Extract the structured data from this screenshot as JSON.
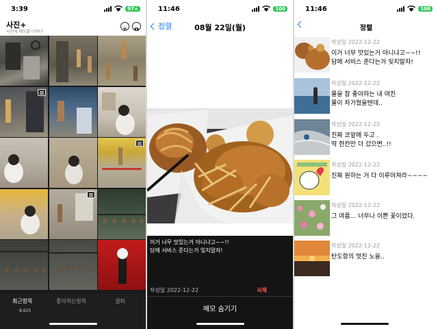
{
  "panel1": {
    "time": "3:39",
    "battery": "97+",
    "title": "사진+",
    "subtitle": "사진에 메모를 더하다",
    "tabs": [
      {
        "label": "최근항목",
        "active": true
      },
      {
        "label": "좋아하는항목",
        "active": false
      },
      {
        "label": "셀피",
        "active": false
      }
    ],
    "count": "8,625"
  },
  "panel2": {
    "time": "11:46",
    "battery": "100",
    "back_label": "정렬",
    "title": "08월 22일(월)",
    "memo": "이거 너무 맛있는거 아니냐고~~!!\n담에 서비스 준다는거 잊지말자!",
    "date": "작성일 2022-12-22",
    "delete_label": "삭제",
    "hide_label": "메모 숨기기"
  },
  "panel3": {
    "time": "11:46",
    "battery": "100",
    "title": "정렬",
    "items": [
      {
        "date": "작성일 2022-12-22",
        "memo": "이거 너무 맛있는거 아니냐고~~!!\n담에 서비스 준다는거 잊지말자!"
      },
      {
        "date": "작성일 2022-12-22",
        "memo": "물을 참 좋아하는 내 여친\n물이 차가웠을텐데.."
      },
      {
        "date": "작성일 2022-12-22",
        "memo": "진짜 코앞에 두고 .\n딱 한칸만 더 갔으면..!!"
      },
      {
        "date": "작성일 2022-12-22",
        "memo": "진짜 원하는 거 다 이루어져라~~~~"
      },
      {
        "date": "작성일 2022-12-22",
        "memo": "그 여름... 너무나 이쁜 꽃이었다."
      },
      {
        "date": "작성일 2022-12-22",
        "memo": "탄도항의 멋진 노을.."
      }
    ]
  },
  "colors": {
    "accent": "#1d7cf7",
    "delete": "#ff5a4e",
    "battery": "#34c759"
  }
}
